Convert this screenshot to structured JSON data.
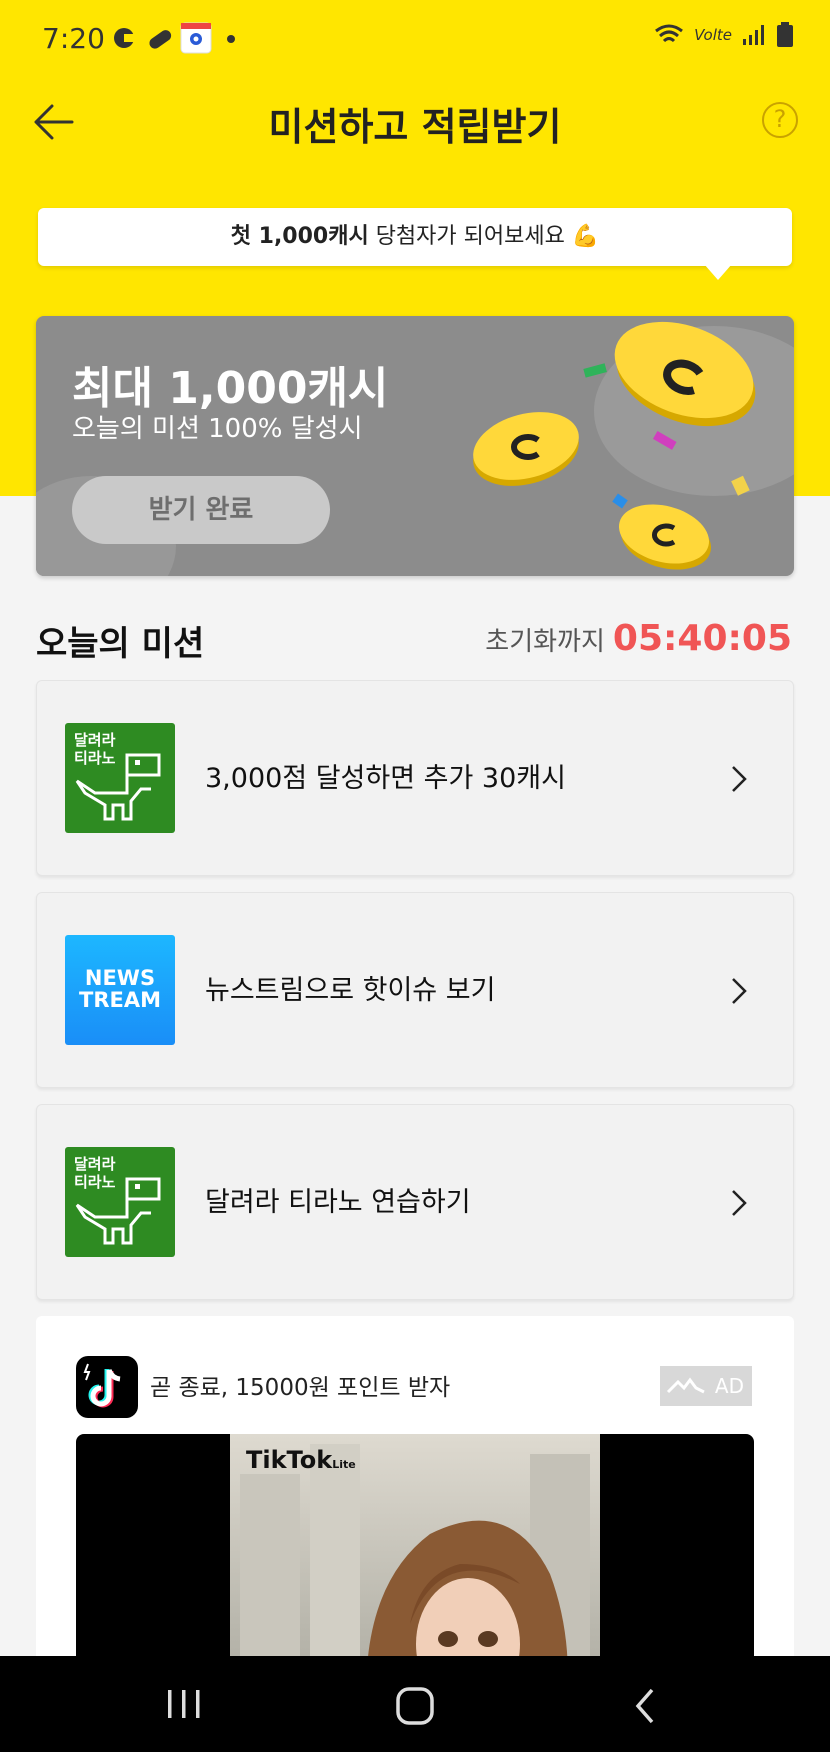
{
  "status_bar": {
    "time": "7:20",
    "network": "Volte"
  },
  "header": {
    "title": "미션하고 적립받기",
    "help_symbol": "?"
  },
  "bubble": {
    "bold": "첫 1,000캐시",
    "rest": " 당첨자가 되어보세요 💪"
  },
  "banner": {
    "headline": "최대 1,000캐시",
    "subtitle": "오늘의 미션 100% 달성시",
    "button_label": "받기 완료"
  },
  "missions": {
    "title": "오늘의 미션",
    "reset_label": "초기화까지",
    "reset_time": "05:40:05",
    "items": [
      {
        "thumb_label_1": "달려라",
        "thumb_label_2": "티라노",
        "label": "3,000점 달성하면 추가 30캐시"
      },
      {
        "thumb_label_1": "NEWS",
        "thumb_label_2": "TREAM",
        "label": "뉴스트림으로 핫이슈 보기"
      },
      {
        "thumb_label_1": "달려라",
        "thumb_label_2": "티라노",
        "label": "달려라 티라노 연습하기"
      }
    ]
  },
  "ad": {
    "text": "곧 종료, 15000원 포인트 받자",
    "badge": "AD",
    "logo_text": "TikTok",
    "logo_sub": "Lite"
  },
  "colors": {
    "brand_yellow": "#ffe600",
    "timer_red": "#f05555",
    "banner_gray": "#8c8c8c",
    "dino_green": "#2e8b22",
    "news_blue": "#1a8ef7"
  }
}
